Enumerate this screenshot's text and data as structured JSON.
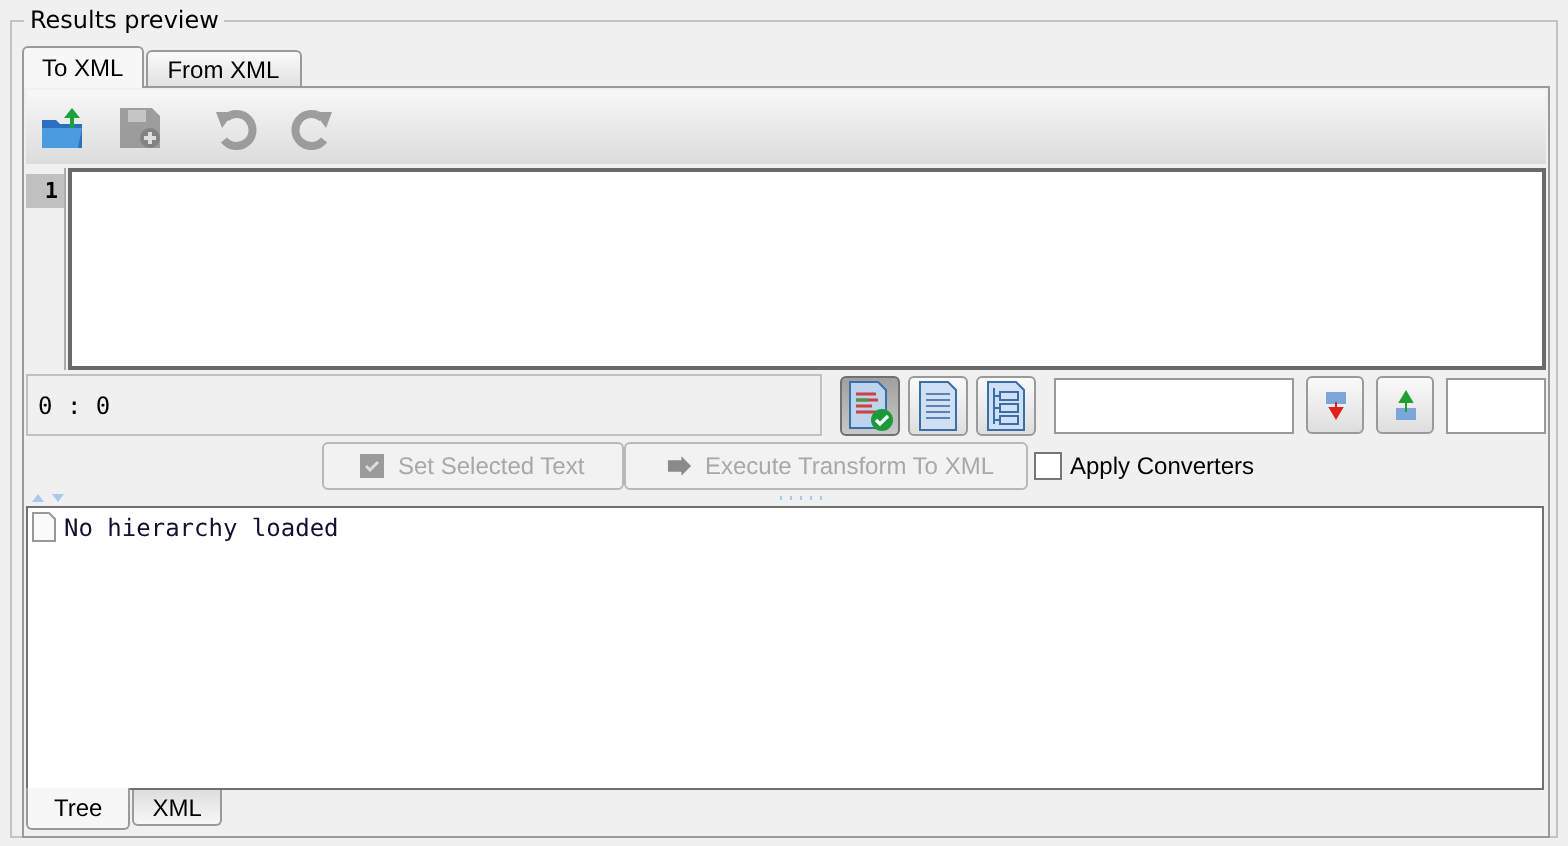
{
  "group": {
    "title": "Results preview"
  },
  "tabs": [
    {
      "label": "To XML",
      "selected": true
    },
    {
      "label": "From XML",
      "selected": false
    }
  ],
  "toolbar": [
    {
      "kind": "open",
      "disabled": false
    },
    {
      "kind": "save",
      "disabled": true
    },
    {
      "kind": "undo",
      "disabled": true
    },
    {
      "kind": "redo",
      "disabled": true
    }
  ],
  "editor": {
    "line_numbers": [
      "1"
    ]
  },
  "status": {
    "position": "0 : 0"
  },
  "view_buttons": [
    {
      "kind": "validated",
      "selected": true
    },
    {
      "kind": "document",
      "selected": false
    },
    {
      "kind": "outline",
      "selected": false
    }
  ],
  "actions": [
    {
      "label": "Set Selected Text",
      "kind": "set",
      "disabled": true
    },
    {
      "label": "Execute Transform To XML",
      "kind": "execute",
      "disabled": true
    }
  ],
  "apply_converters": {
    "label": "Apply Converters",
    "checked": false
  },
  "tree": {
    "items": [
      {
        "label": "No hierarchy loaded"
      }
    ]
  },
  "bottom_tabs": [
    {
      "label": "Tree",
      "selected": true
    },
    {
      "label": "XML",
      "selected": false
    }
  ]
}
